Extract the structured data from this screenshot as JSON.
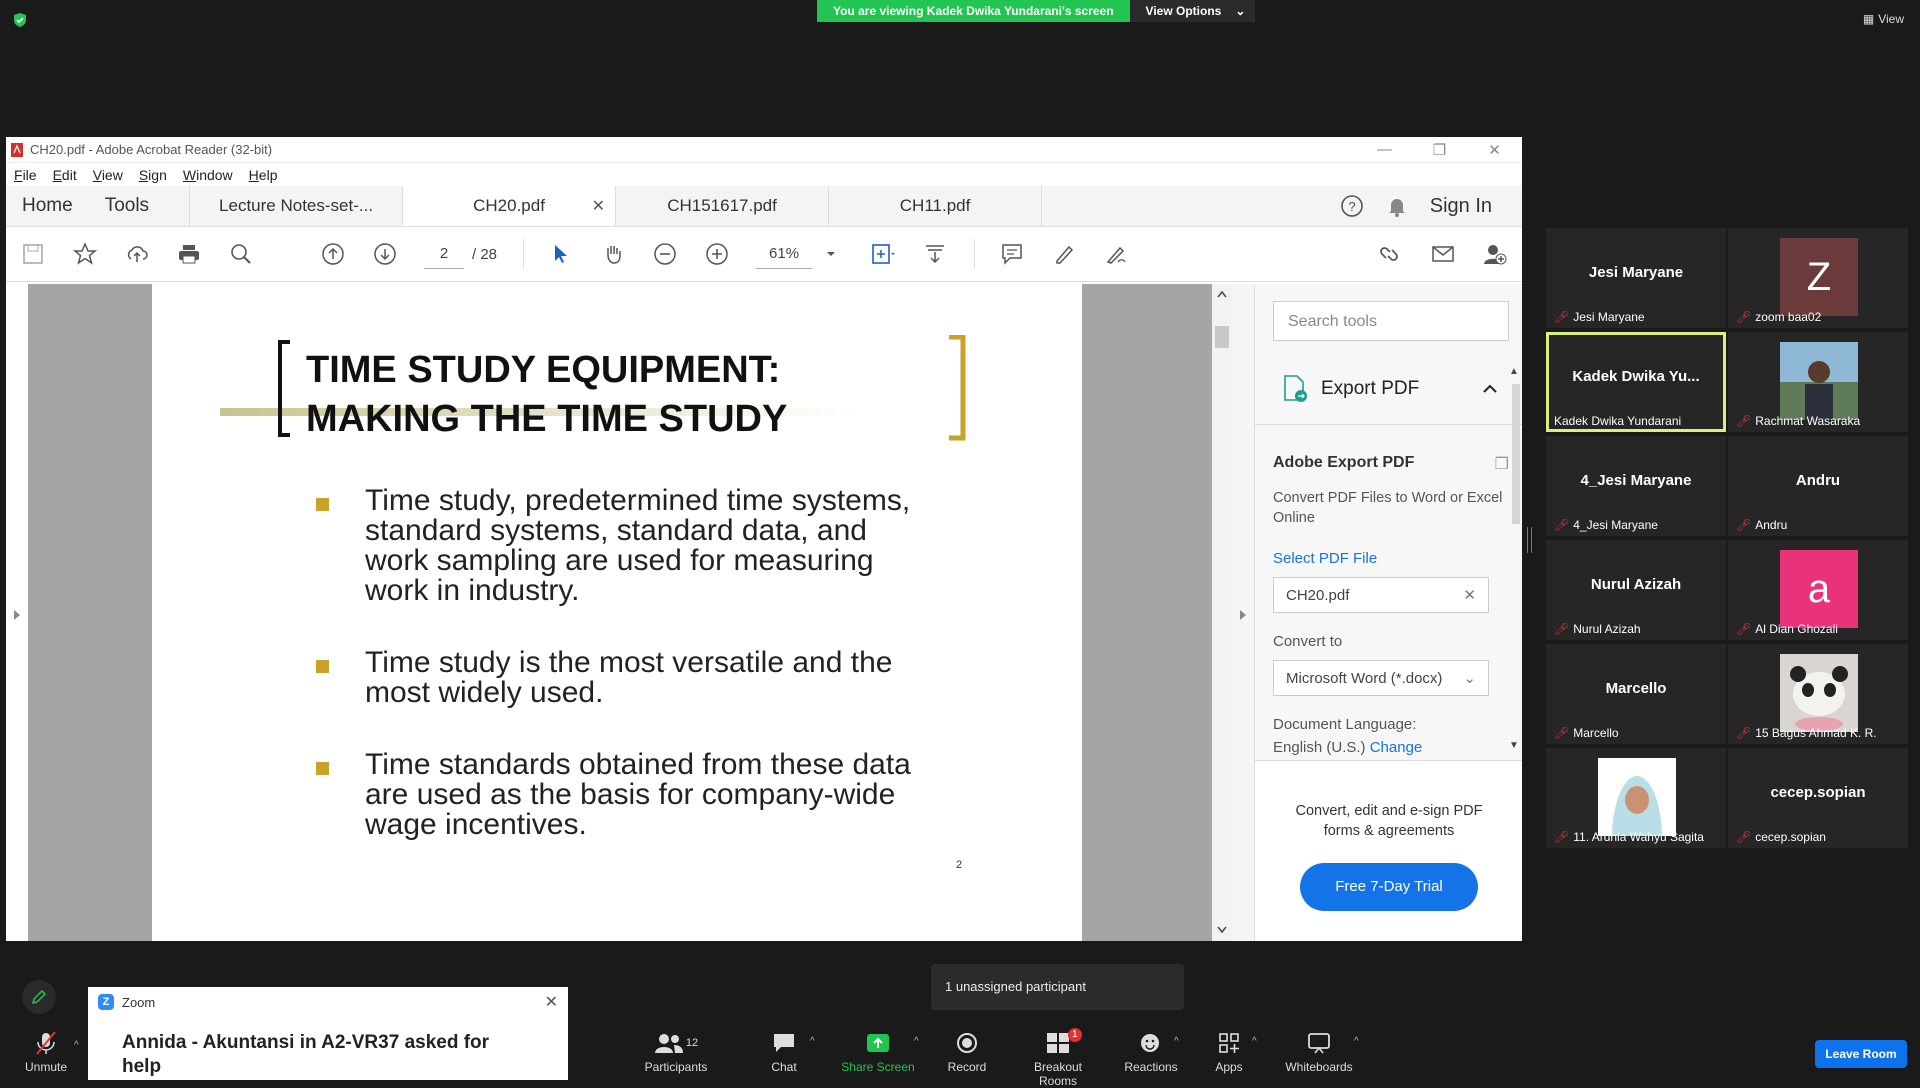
{
  "zoom": {
    "viewing_banner": "You are viewing Kadek Dwika Yundarani's screen",
    "view_options": "View Options",
    "view_label": "View",
    "unassigned": "1 unassigned participant",
    "leave": "Leave Room",
    "controls": {
      "unmute": "Unmute",
      "participants": "Participants",
      "participants_count": "12",
      "chat": "Chat",
      "share": "Share Screen",
      "record": "Record",
      "breakout": "Breakout Rooms",
      "breakout_badge": "1",
      "reactions": "Reactions",
      "apps": "Apps",
      "whiteboards": "Whiteboards"
    },
    "notification": {
      "app": "Zoom",
      "message": "Annida - Akuntansi in A2-VR37 asked for help"
    },
    "participants": [
      {
        "display": "Jesi Maryane",
        "label": "Jesi Maryane"
      },
      {
        "display": "Z",
        "label": "zoom baa02",
        "avatar_color": "#6b3a3a"
      },
      {
        "display": "Kadek Dwika Yu...",
        "label": "Kadek Dwika Yundarani",
        "active": true
      },
      {
        "display": "",
        "label": "Rachmat Wasaraka",
        "photo": true
      },
      {
        "display": "4_Jesi Maryane",
        "label": "4_Jesi Maryane"
      },
      {
        "display": "Andru",
        "label": "Andru"
      },
      {
        "display": "Nurul Azizah",
        "label": "Nurul Azizah"
      },
      {
        "display": "a",
        "label": "Al Dian Ghozali",
        "avatar_color": "#e8337a"
      },
      {
        "display": "Marcello",
        "label": "Marcello"
      },
      {
        "display": "",
        "label": "15 Bagus Ahmad K. R.",
        "photo": true
      },
      {
        "display": "",
        "label": "11. Ardhia Wahyu Sagita",
        "photo": true
      },
      {
        "display": "cecep.sopian",
        "label": "cecep.sopian"
      }
    ]
  },
  "acrobat": {
    "window_title": "CH20.pdf - Adobe Acrobat Reader (32-bit)",
    "menu": [
      "File",
      "Edit",
      "View",
      "Sign",
      "Window",
      "Help"
    ],
    "nav_home": "Home",
    "nav_tools": "Tools",
    "tabs": [
      "Lecture Notes-set-...",
      "CH20.pdf",
      "CH151617.pdf",
      "CH11.pdf"
    ],
    "active_tab": 1,
    "sign_in": "Sign In",
    "page_current": "2",
    "page_total": "/ 28",
    "zoom": "61%",
    "slide": {
      "title_line1": "TIME STUDY EQUIPMENT:",
      "title_line2": "MAKING THE TIME STUDY",
      "bullets": [
        "Time study, predetermined time systems, standard systems, standard data, and work sampling are used for measuring work in industry.",
        "Time study is the most versatile and the most widely used.",
        "Time standards obtained from these data are used as the basis for company-wide wage incentives."
      ],
      "page_number": "2"
    },
    "tools_pane": {
      "search_placeholder": "Search tools",
      "export_title": "Export PDF",
      "section_title": "Adobe Export PDF",
      "description": "Convert PDF Files to Word or Excel Online",
      "select_label": "Select PDF File",
      "selected_file": "CH20.pdf",
      "convert_to_label": "Convert to",
      "convert_to_value": "Microsoft Word (*.docx)",
      "doc_lang_label": "Document Language:",
      "doc_lang_value": "English (U.S.)",
      "change_link": "Change",
      "promo": "Convert, edit and e-sign PDF forms & agreements",
      "trial_button": "Free 7-Day Trial"
    }
  }
}
